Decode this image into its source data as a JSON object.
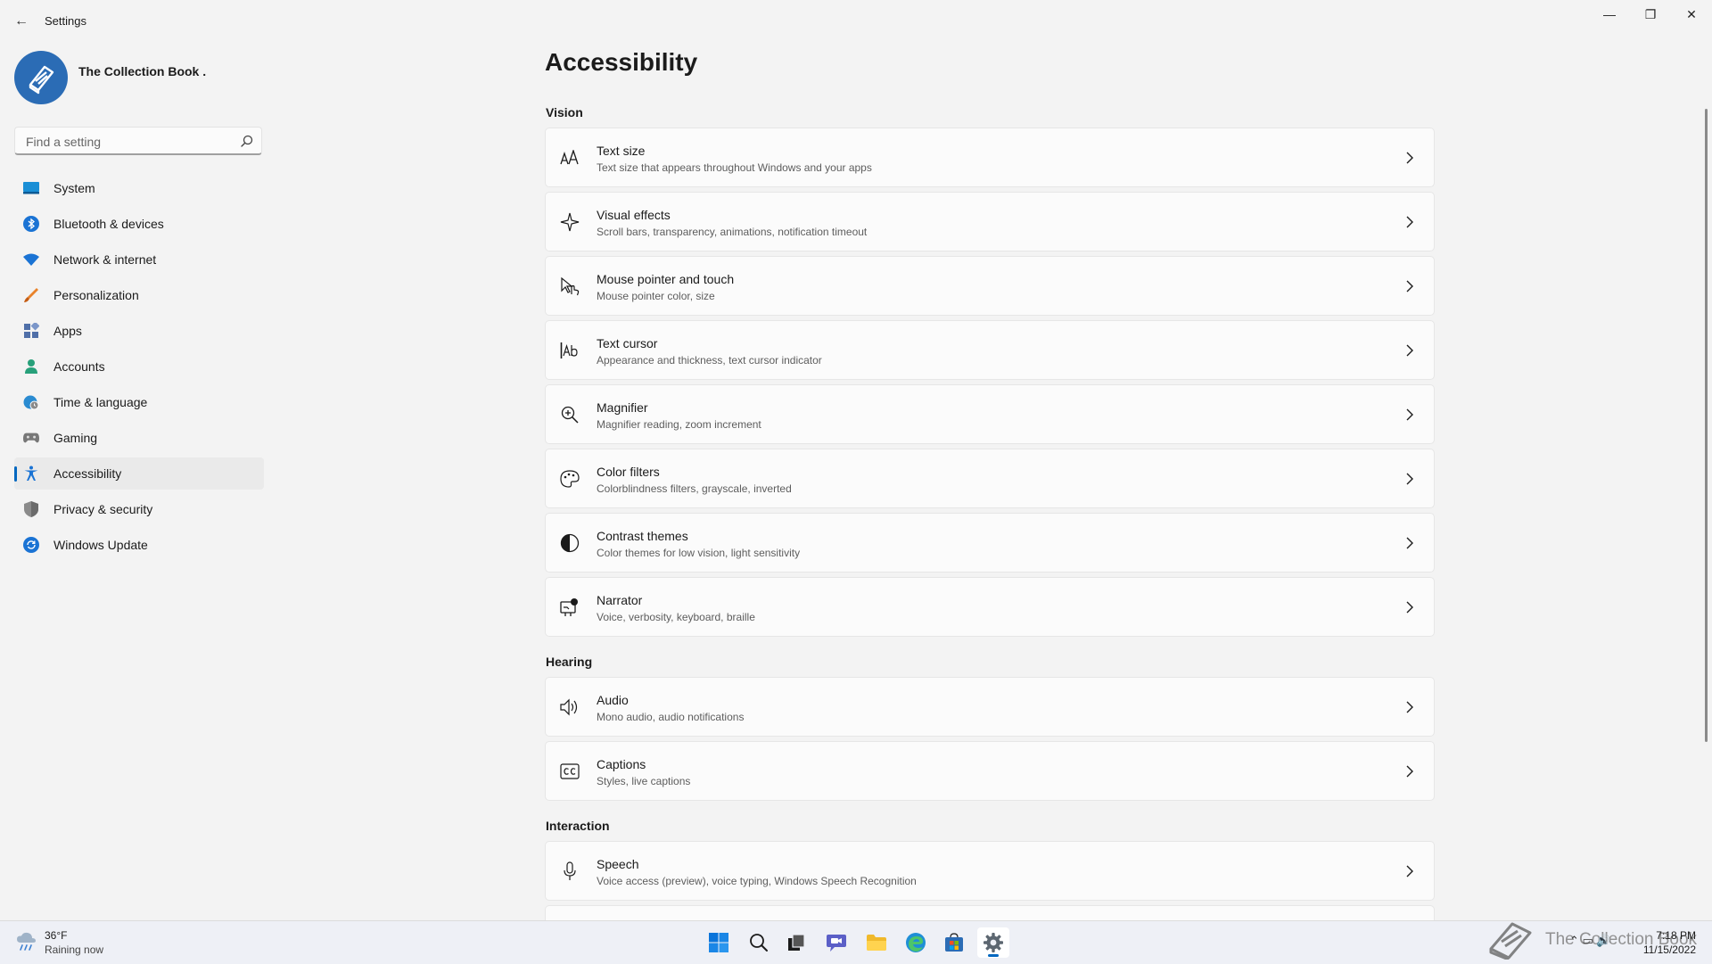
{
  "window": {
    "title": "Settings",
    "back_glyph": "←",
    "minimize_glyph": "—",
    "maximize_glyph": "❐",
    "close_glyph": "✕"
  },
  "profile": {
    "name": "The Collection Book ."
  },
  "search": {
    "placeholder": "Find a setting"
  },
  "nav": {
    "active": "Accessibility",
    "items": [
      {
        "label": "System",
        "icon": "monitor-icon"
      },
      {
        "label": "Bluetooth & devices",
        "icon": "bluetooth-icon"
      },
      {
        "label": "Network & internet",
        "icon": "wifi-icon"
      },
      {
        "label": "Personalization",
        "icon": "brush-icon"
      },
      {
        "label": "Apps",
        "icon": "apps-icon"
      },
      {
        "label": "Accounts",
        "icon": "person-icon"
      },
      {
        "label": "Time & language",
        "icon": "globe-clock-icon"
      },
      {
        "label": "Gaming",
        "icon": "gamepad-icon"
      },
      {
        "label": "Accessibility",
        "icon": "accessibility-icon"
      },
      {
        "label": "Privacy & security",
        "icon": "shield-icon"
      },
      {
        "label": "Windows Update",
        "icon": "update-icon"
      }
    ]
  },
  "main": {
    "title": "Accessibility",
    "sections": [
      {
        "heading": "Vision",
        "items": [
          {
            "title": "Text size",
            "subtitle": "Text size that appears throughout Windows and your apps",
            "icon": "text-size-icon"
          },
          {
            "title": "Visual effects",
            "subtitle": "Scroll bars, transparency, animations, notification timeout",
            "icon": "sparkle-icon"
          },
          {
            "title": "Mouse pointer and touch",
            "subtitle": "Mouse pointer color, size",
            "icon": "pointer-touch-icon"
          },
          {
            "title": "Text cursor",
            "subtitle": "Appearance and thickness, text cursor indicator",
            "icon": "text-cursor-icon"
          },
          {
            "title": "Magnifier",
            "subtitle": "Magnifier reading, zoom increment",
            "icon": "magnifier-icon"
          },
          {
            "title": "Color filters",
            "subtitle": "Colorblindness filters, grayscale, inverted",
            "icon": "palette-icon"
          },
          {
            "title": "Contrast themes",
            "subtitle": "Color themes for low vision, light sensitivity",
            "icon": "contrast-icon"
          },
          {
            "title": "Narrator",
            "subtitle": "Voice, verbosity, keyboard, braille",
            "icon": "narrator-icon"
          }
        ]
      },
      {
        "heading": "Hearing",
        "items": [
          {
            "title": "Audio",
            "subtitle": "Mono audio, audio notifications",
            "icon": "speaker-icon"
          },
          {
            "title": "Captions",
            "subtitle": "Styles, live captions",
            "icon": "captions-icon"
          }
        ]
      },
      {
        "heading": "Interaction",
        "items": [
          {
            "title": "Speech",
            "subtitle": "Voice access (preview), voice typing, Windows Speech Recognition",
            "icon": "microphone-icon"
          }
        ]
      }
    ]
  },
  "taskbar": {
    "weather": {
      "temp": "36°F",
      "desc": "Raining now",
      "icon": "rain-cloud-icon"
    },
    "apps": [
      {
        "name": "start",
        "icon": "windows-logo-icon"
      },
      {
        "name": "search",
        "icon": "search-icon"
      },
      {
        "name": "task-view",
        "icon": "task-view-icon"
      },
      {
        "name": "chat",
        "icon": "chat-icon"
      },
      {
        "name": "file-explorer",
        "icon": "folder-icon"
      },
      {
        "name": "edge",
        "icon": "edge-icon"
      },
      {
        "name": "store",
        "icon": "store-icon"
      },
      {
        "name": "settings",
        "icon": "gear-icon",
        "active": true
      }
    ],
    "watermark": "The Collection Book",
    "tray_glyphs": "⌃  ▭  🔊",
    "clock": {
      "time": "7:18 PM",
      "date": "11/15/2022"
    }
  },
  "colors": {
    "accent": "#0067c0",
    "background": "#f3f3f3",
    "card": "#fbfbfb"
  }
}
